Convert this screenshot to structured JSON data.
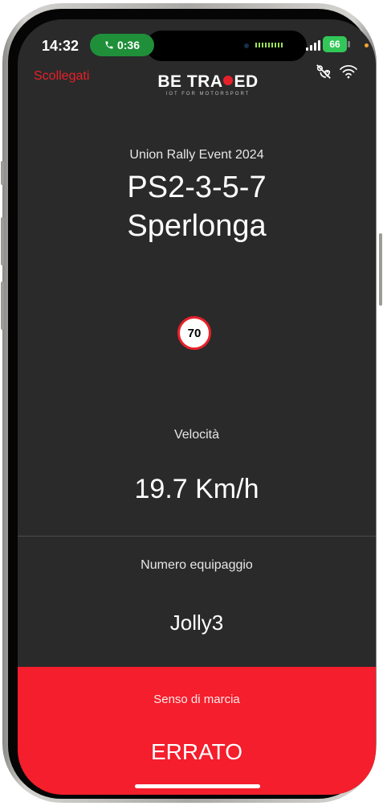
{
  "status_bar": {
    "time": "14:32",
    "call_duration": "0:36",
    "battery_level": "66",
    "icons": [
      "phone-icon",
      "signal-icon",
      "battery-icon"
    ]
  },
  "header": {
    "disconnect_label": "Scollegati",
    "logo_part1": "BE TRA",
    "logo_part2": "ED",
    "logo_tagline": "IOT FOR MOTORSPORT",
    "icons": [
      "gps-off-icon",
      "wifi-icon"
    ]
  },
  "stage": {
    "event_name": "Union Rally Event 2024",
    "stage_code": "PS2-3-5-7",
    "stage_location": "Sperlonga"
  },
  "speed_limit": {
    "value": "70"
  },
  "speed": {
    "label": "Velocità",
    "value": "19.7 Km/h"
  },
  "crew": {
    "label": "Numero equipaggio",
    "value": "Jolly3"
  },
  "direction": {
    "label": "Senso di marcia",
    "value": "ERRATO"
  },
  "colors": {
    "background": "#2a2a2a",
    "accent_red": "#f41e2c",
    "call_green": "#1f8f3a",
    "battery_green": "#33c759"
  }
}
